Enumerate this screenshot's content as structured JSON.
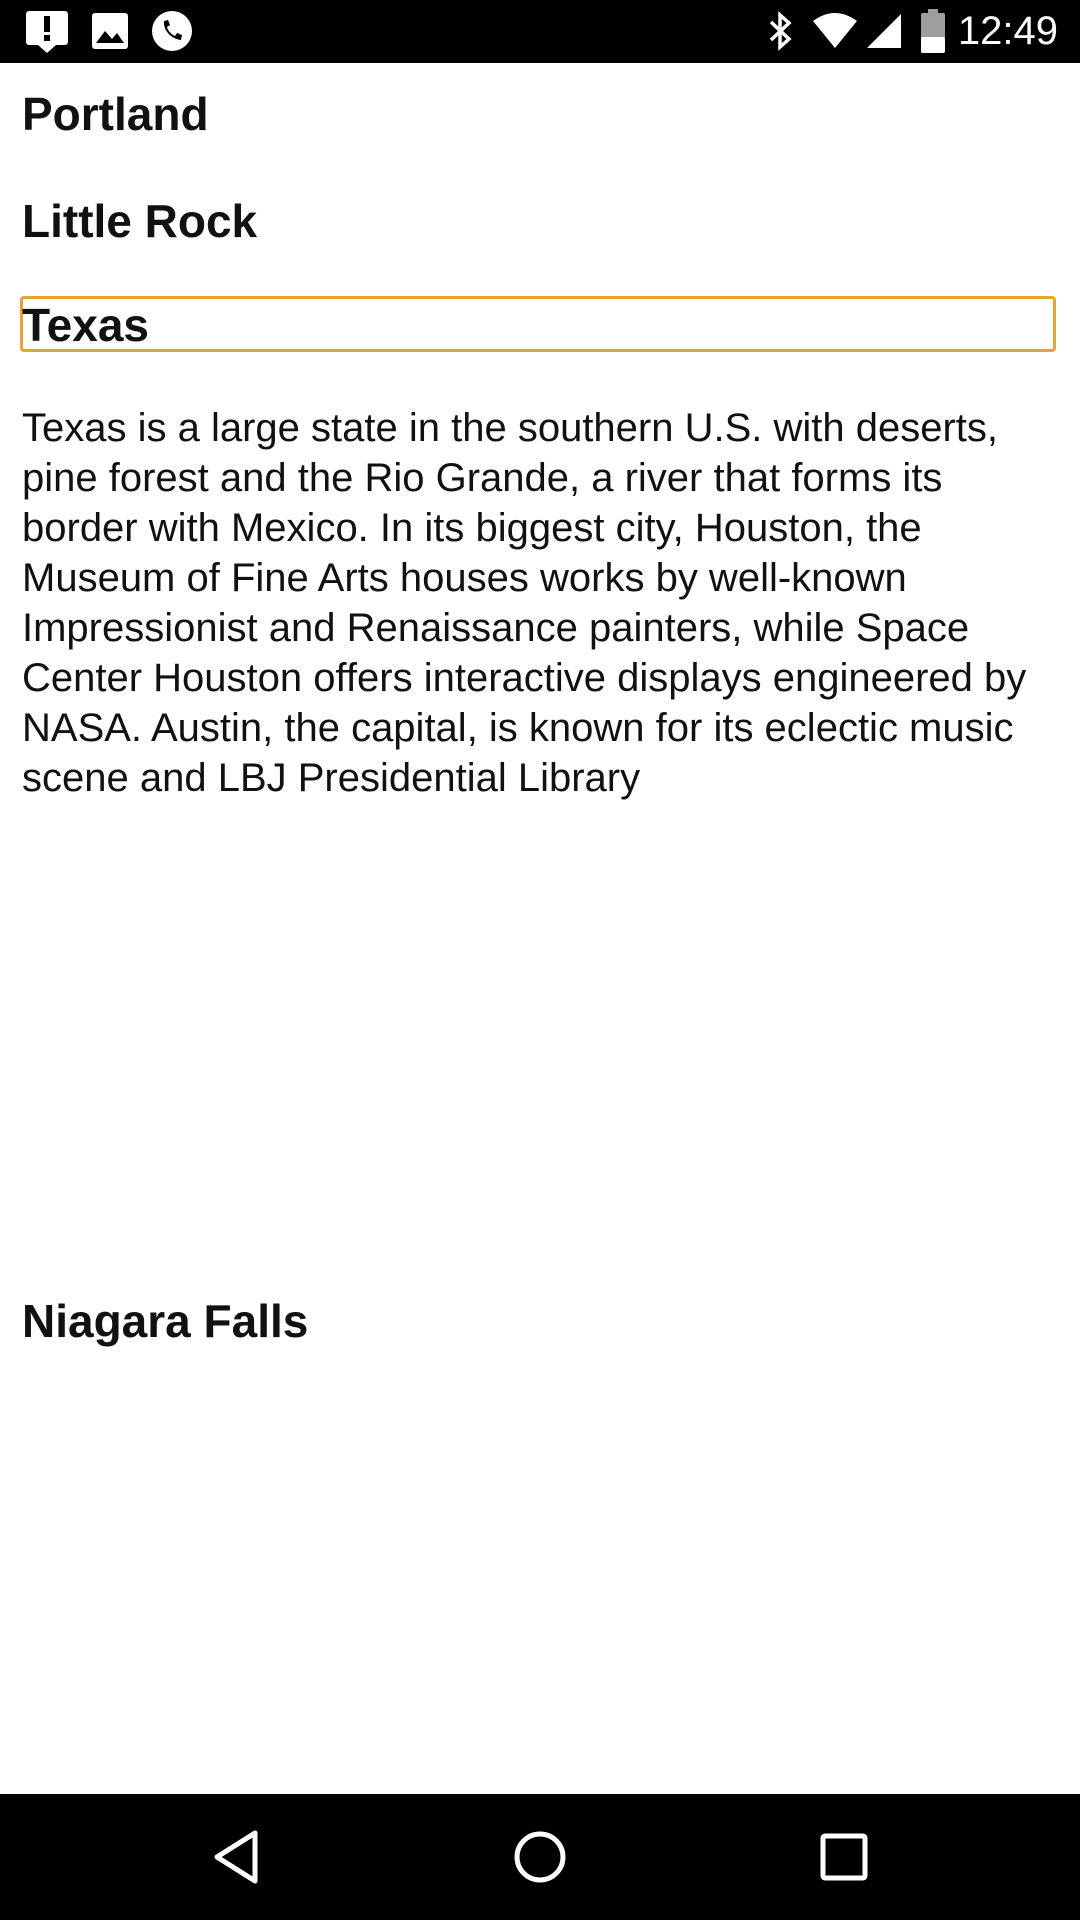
{
  "status_bar": {
    "time": "12:49",
    "left_icons": [
      "alert-icon",
      "image-icon",
      "phone-icon"
    ],
    "right_icons": [
      "bluetooth-icon",
      "wifi-icon",
      "signal-icon",
      "battery-icon"
    ]
  },
  "list": {
    "items": [
      {
        "title": "Portland"
      },
      {
        "title": "Little Rock"
      },
      {
        "title": "Texas",
        "description": "Texas is a large state in the southern U.S. with deserts, pine forest and the Rio Grande, a river that forms its border with Mexico. In its biggest city, Houston, the Museum of Fine Arts houses works by well-known Impressionist and Renaissance painters, while Space Center Houston offers interactive displays engineered by NASA. Austin, the capital, is known for its eclectic music scene and LBJ Presidential Library"
      },
      {
        "title": "Niagara Falls"
      }
    ]
  },
  "nav_bar": {
    "buttons": [
      "back-icon",
      "home-icon",
      "recents-icon"
    ]
  },
  "colors": {
    "focus_outline": "#e3a533",
    "bars": "#000000"
  }
}
